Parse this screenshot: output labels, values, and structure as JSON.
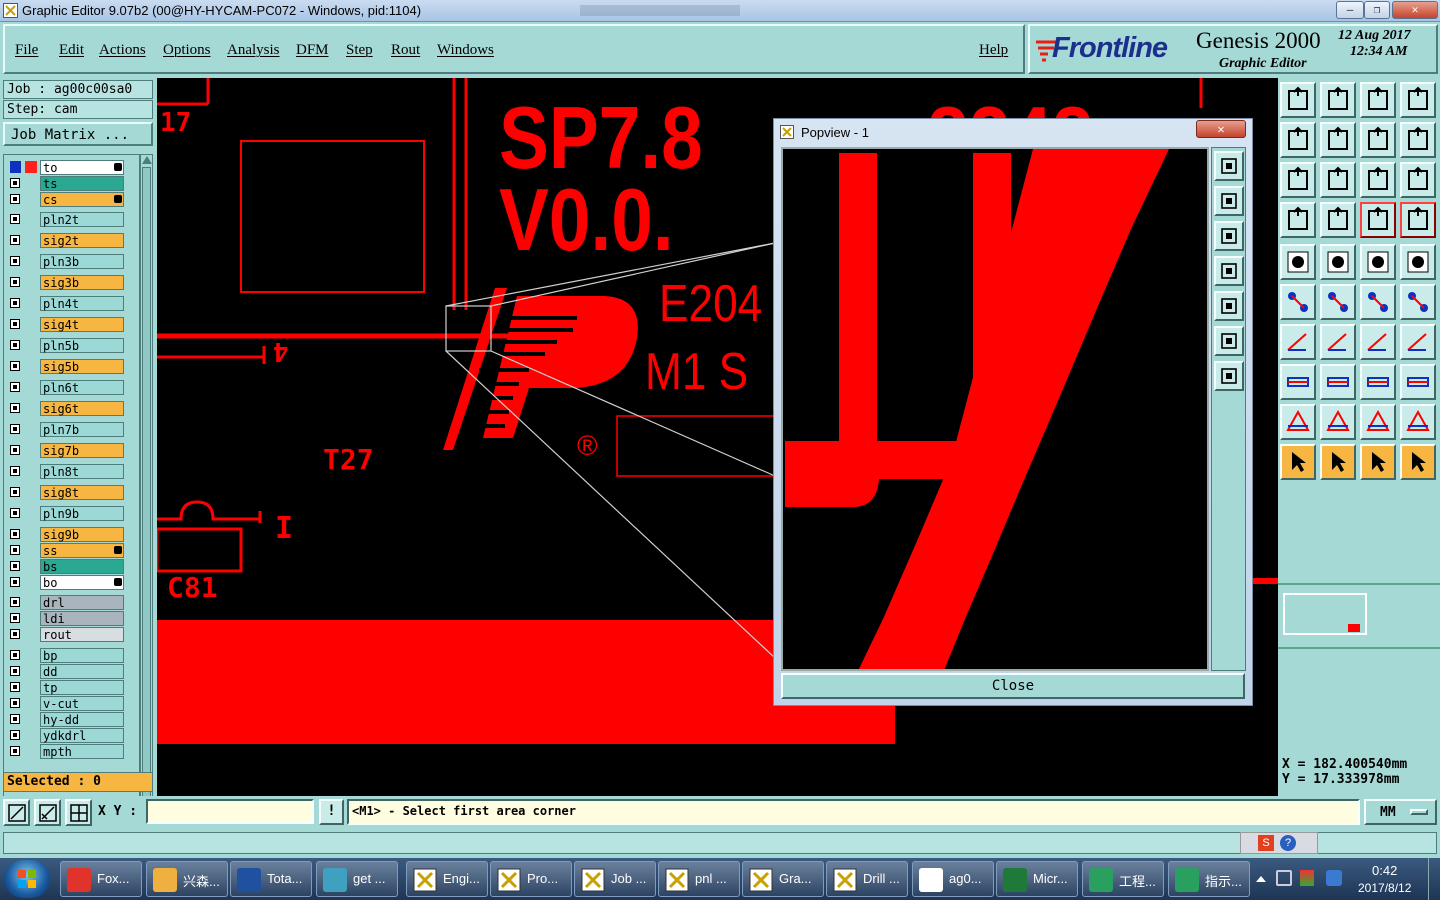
{
  "window": {
    "title": "Graphic Editor 9.07b2 (00@HY-HYCAM-PC072 - Windows, pid:1104)",
    "min": "–",
    "max": "❐",
    "close": "✕"
  },
  "menu": {
    "items": [
      "File",
      "Edit",
      "Actions",
      "Options",
      "Analysis",
      "DFM",
      "Step",
      "Rout",
      "Windows"
    ],
    "help": "Help"
  },
  "brand": {
    "logo": "Frontline",
    "product": "Genesis 2000",
    "subtitle": "Graphic Editor",
    "date": "12 Aug 2017",
    "time": "12:34 AM"
  },
  "job": {
    "job_label": "Job : ag00c00sa0",
    "step_label": "Step: cam",
    "matrix_button": "Job Matrix ..."
  },
  "layers": [
    {
      "name": "to",
      "color": "#ffffff",
      "hand": true
    },
    {
      "name": "ts",
      "color": "#2aa891"
    },
    {
      "name": "cs",
      "color": "#f7b642",
      "hand": true
    },
    {
      "name": "pln2t",
      "color": "#9cd9d6"
    },
    {
      "name": "sig2t",
      "color": "#f7b642"
    },
    {
      "name": "pln3b",
      "color": "#9cd9d6"
    },
    {
      "name": "sig3b",
      "color": "#f7b642"
    },
    {
      "name": "pln4t",
      "color": "#9cd9d6"
    },
    {
      "name": "sig4t",
      "color": "#f7b642"
    },
    {
      "name": "pln5b",
      "color": "#9cd9d6"
    },
    {
      "name": "sig5b",
      "color": "#f7b642"
    },
    {
      "name": "pln6t",
      "color": "#9cd9d6"
    },
    {
      "name": "sig6t",
      "color": "#f7b642"
    },
    {
      "name": "pln7b",
      "color": "#9cd9d6"
    },
    {
      "name": "sig7b",
      "color": "#f7b642"
    },
    {
      "name": "pln8t",
      "color": "#9cd9d6"
    },
    {
      "name": "sig8t",
      "color": "#f7b642"
    },
    {
      "name": "pln9b",
      "color": "#9cd9d6"
    },
    {
      "name": "sig9b",
      "color": "#f7b642"
    },
    {
      "name": "ss",
      "color": "#f7b642",
      "hand": true
    },
    {
      "name": "bs",
      "color": "#2aa891"
    },
    {
      "name": "bo",
      "color": "#ffffff",
      "hand": true
    },
    {
      "name": "drl",
      "color": "#aab4bd"
    },
    {
      "name": "ldi",
      "color": "#aab4bd"
    },
    {
      "name": "rout",
      "color": "#d7dde1"
    },
    {
      "name": "bp",
      "color": "#9cd9d6"
    },
    {
      "name": "dd",
      "color": "#9cd9d6"
    },
    {
      "name": "tp",
      "color": "#9cd9d6"
    },
    {
      "name": "v-cut",
      "color": "#9cd9d6"
    },
    {
      "name": "hy-dd",
      "color": "#9cd9d6"
    },
    {
      "name": "ydkdrl",
      "color": "#9cd9d6"
    },
    {
      "name": "mpth",
      "color": "#9cd9d6"
    }
  ],
  "selected": "Selected : 0",
  "canvas_text": {
    "t1": "SP7.8",
    "t2": "V0.0.",
    "t3": "E204",
    "t4": "M1 S",
    "t5": "T27",
    "t6": "C81",
    "t7": "17",
    "t8": "4",
    "t9": "I",
    "t10": "®",
    "t11": "8248"
  },
  "popview": {
    "title": "Popview - 1",
    "close_label": "Close"
  },
  "coords": {
    "x": "X = 182.400540mm",
    "y": "Y = 17.333978mm"
  },
  "command": {
    "xy_label": "X Y :",
    "input_value": "",
    "prompt": "<M1> - Select first area corner",
    "units": "MM"
  },
  "taskbar": {
    "items": [
      {
        "label": "Fox...",
        "icon": "foxit-icon",
        "color": "#e0332b"
      },
      {
        "label": "兴森...",
        "icon": "flower-icon",
        "color": "#f0b040"
      },
      {
        "label": "Tota...",
        "icon": "floppy-icon",
        "color": "#2050a0"
      },
      {
        "label": "get ...",
        "icon": "eye-icon",
        "color": "#40a0c0"
      },
      {
        "label": "Engi...",
        "icon": "genesis-window-icon",
        "color": "#ffffff"
      },
      {
        "label": "Pro...",
        "icon": "genesis-window-icon",
        "color": "#ffffff"
      },
      {
        "label": "Job ...",
        "icon": "genesis-window-icon",
        "color": "#ffffff"
      },
      {
        "label": "pnl ...",
        "icon": "genesis-window-icon",
        "color": "#ffffff"
      },
      {
        "label": "Gra...",
        "icon": "genesis-window-icon",
        "color": "#ffffff"
      },
      {
        "label": "Drill ...",
        "icon": "genesis-window-icon",
        "color": "#ffffff"
      },
      {
        "label": "ag0...",
        "icon": "document-icon",
        "color": "#ffffff"
      },
      {
        "label": "Micr...",
        "icon": "excel-icon",
        "color": "#1f7a3a"
      },
      {
        "label": "工程...",
        "icon": "frontline-f-icon",
        "color": "#2aa060"
      },
      {
        "label": "指示...",
        "icon": "frontline-f-icon",
        "color": "#2aa060"
      }
    ],
    "clock_time": "0:42",
    "clock_date": "2017/8/12"
  }
}
